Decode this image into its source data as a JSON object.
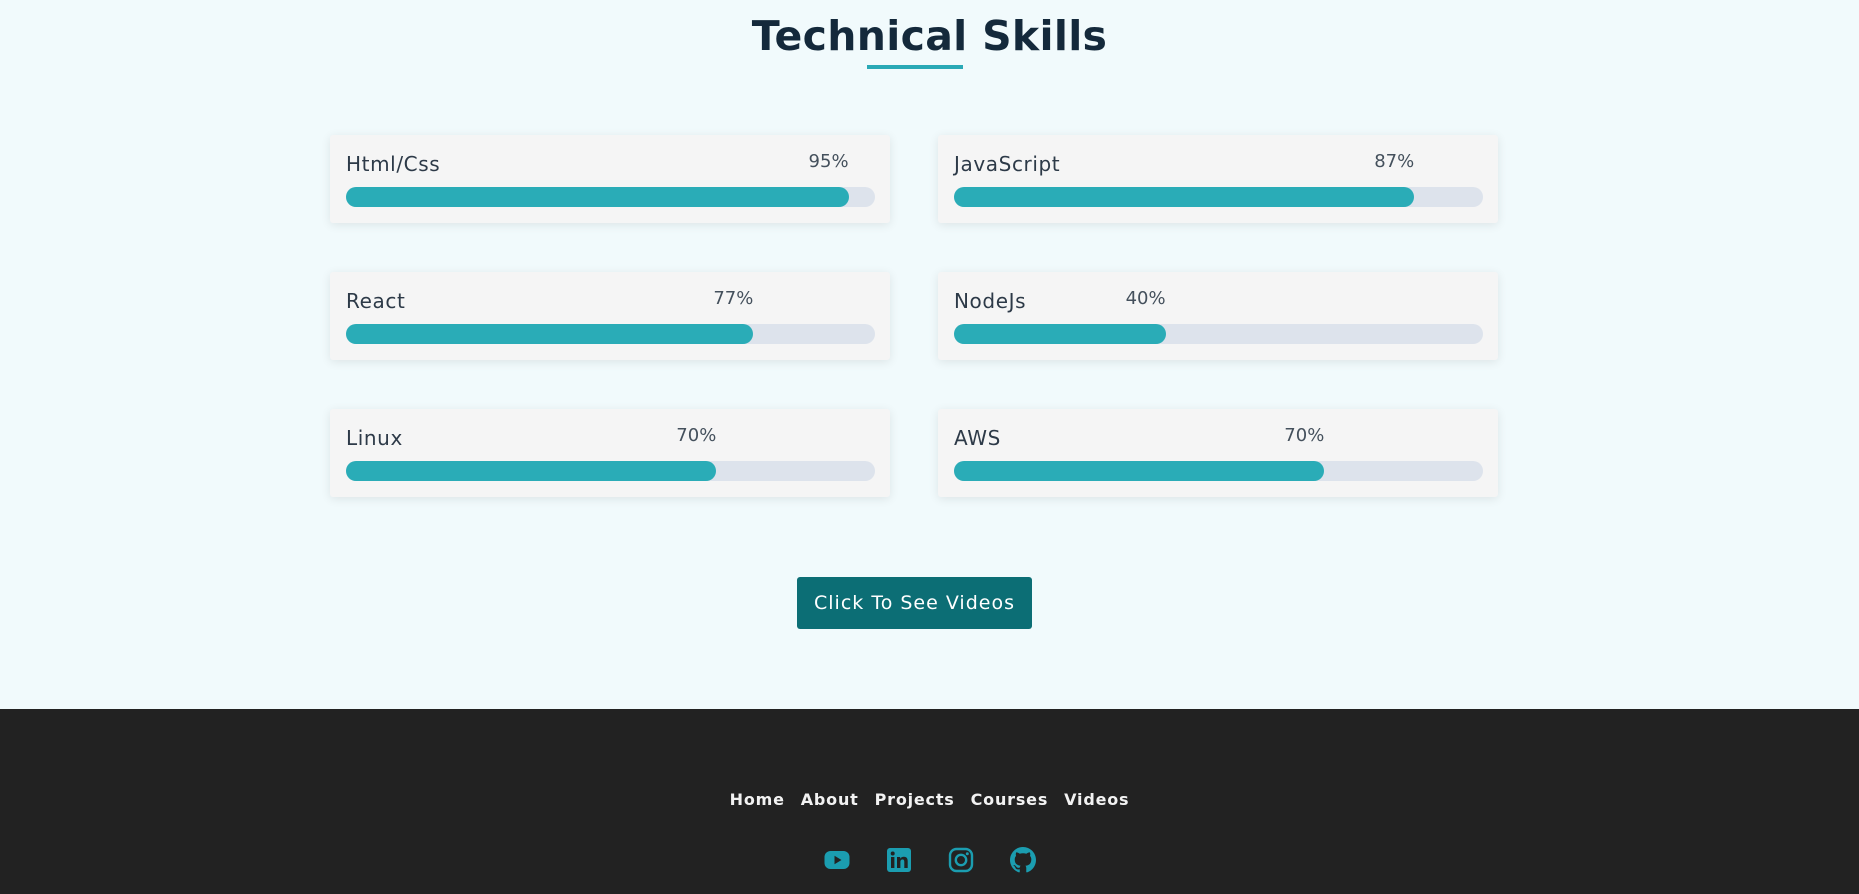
{
  "heading": "Technical Skills",
  "colors": {
    "accent": "#2aacb7",
    "track": "#dde3ec",
    "button": "#0c6e75",
    "footer_bg": "#222222",
    "title": "#14293b"
  },
  "skills": [
    {
      "name": "Html/Css",
      "percent_label": "95%",
      "value": 95
    },
    {
      "name": "JavaScript",
      "percent_label": "87%",
      "value": 87
    },
    {
      "name": "React",
      "percent_label": "77%",
      "value": 77
    },
    {
      "name": "NodeJs",
      "percent_label": "40%",
      "value": 40
    },
    {
      "name": "Linux",
      "percent_label": "70%",
      "value": 70
    },
    {
      "name": "AWS",
      "percent_label": "70%",
      "value": 70
    }
  ],
  "cta_button": "Click To See Videos",
  "footer": {
    "nav": [
      "Home",
      "About",
      "Projects",
      "Courses",
      "Videos"
    ],
    "social_icons": [
      "youtube-icon",
      "linkedin-icon",
      "instagram-icon",
      "github-icon"
    ]
  }
}
